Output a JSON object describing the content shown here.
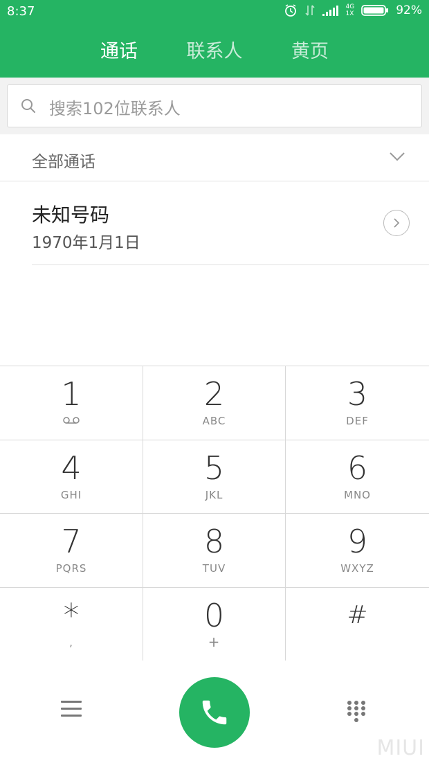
{
  "status_bar": {
    "time": "8:37",
    "network": "4G",
    "network2": "1X",
    "battery": "92%"
  },
  "tabs": [
    {
      "label": "通话",
      "active": true
    },
    {
      "label": "联系人",
      "active": false
    },
    {
      "label": "黄页",
      "active": false
    }
  ],
  "search": {
    "placeholder": "搜索102位联系人"
  },
  "filter": {
    "label": "全部通话"
  },
  "call_log": [
    {
      "name": "未知号码",
      "date": "1970年1月1日"
    }
  ],
  "keypad": [
    {
      "digit": "1",
      "letters": ""
    },
    {
      "digit": "2",
      "letters": "ABC"
    },
    {
      "digit": "3",
      "letters": "DEF"
    },
    {
      "digit": "4",
      "letters": "GHI"
    },
    {
      "digit": "5",
      "letters": "JKL"
    },
    {
      "digit": "6",
      "letters": "MNO"
    },
    {
      "digit": "7",
      "letters": "PQRS"
    },
    {
      "digit": "8",
      "letters": "TUV"
    },
    {
      "digit": "9",
      "letters": "WXYZ"
    },
    {
      "digit": "*",
      "letters": ","
    },
    {
      "digit": "0",
      "letters": "+"
    },
    {
      "digit": "#",
      "letters": ""
    }
  ],
  "colors": {
    "accent": "#25b463"
  },
  "watermark": "MIUI"
}
